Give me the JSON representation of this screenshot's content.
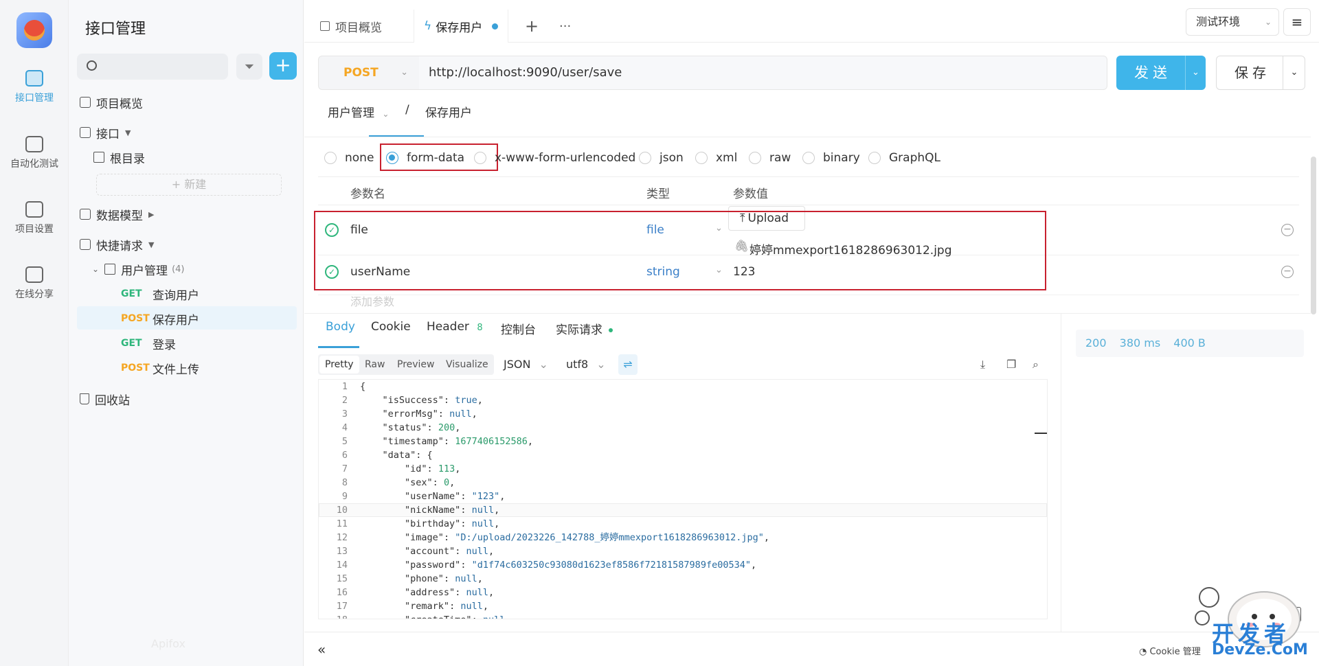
{
  "rail": {
    "items": [
      {
        "label": "接口管理",
        "icon": "api-icon",
        "active": true
      },
      {
        "label": "自动化测试",
        "icon": "automation-icon",
        "active": false
      },
      {
        "label": "项目设置",
        "icon": "settings-icon",
        "active": false
      },
      {
        "label": "在线分享",
        "icon": "share-icon",
        "active": false
      }
    ]
  },
  "sidebar": {
    "title": "接口管理",
    "search_placeholder": "",
    "overview": "项目概览",
    "interfaces": "接口",
    "root": "根目录",
    "new_label": "+ 新建",
    "data_model": "数据模型",
    "quick_requests": "快捷请求",
    "user_group": "用户管理",
    "user_group_count": "(4)",
    "requests": [
      {
        "method": "GET",
        "name": "查询用户"
      },
      {
        "method": "POST",
        "name": "保存用户"
      },
      {
        "method": "GET",
        "name": "登录"
      },
      {
        "method": "POST",
        "name": "文件上传"
      }
    ],
    "recycle": "回收站",
    "watermark": "Apifox"
  },
  "tabs": [
    {
      "label": "项目概览"
    },
    {
      "label": "保存用户"
    }
  ],
  "tab_add": "+",
  "tab_more": "···",
  "environment": "测试环境",
  "request": {
    "method": "POST",
    "url": "http://localhost:9090/user/save",
    "send_label": "发送",
    "save_label": "保存",
    "breadcrumb_parent": "用户管理",
    "breadcrumb_sep": "/",
    "breadcrumb_current": "保存用户"
  },
  "body_types": [
    "none",
    "form-data",
    "x-www-form-urlencoded",
    "json",
    "xml",
    "raw",
    "binary",
    "GraphQL"
  ],
  "params_header": {
    "name": "参数名",
    "type": "类型",
    "value": "参数值"
  },
  "params": [
    {
      "name": "file",
      "type": "file",
      "upload": "Upload",
      "value": "婷婷mmexport1618286963012.jpg"
    },
    {
      "name": "userName",
      "type": "string",
      "value": "123"
    }
  ],
  "add_param": "添加参数",
  "response": {
    "tabs": [
      "Body",
      "Cookie",
      "Header",
      "控制台",
      "实际请求"
    ],
    "header_count": "8",
    "formats": [
      "Pretty",
      "Raw",
      "Preview",
      "Visualize"
    ],
    "lang": "JSON",
    "encoding": "utf8",
    "status": "200",
    "time": "380 ms",
    "size": "400 B",
    "lines": [
      "{",
      "    \"isSuccess\": true,",
      "    \"errorMsg\": null,",
      "    \"status\": 200,",
      "    \"timestamp\": 1677406152586,",
      "    \"data\": {",
      "        \"id\": 113,",
      "        \"sex\": 0,",
      "        \"userName\": \"123\",",
      "        \"nickName\": null,",
      "        \"birthday\": null,",
      "        \"image\": \"D:/upload/2023226_142788_婷婷mmexport1618286963012.jpg\",",
      "        \"account\": null,",
      "        \"password\": \"d1f74c603250c93080d1623ef8586f72181587989fe00534\",",
      "        \"phone\": null,",
      "        \"address\": null,",
      "        \"remark\": null,",
      "        \"createTime\": null"
    ]
  },
  "footer": {
    "collapse": "«",
    "cookie": "Cookie 管理",
    "brand": "开发者",
    "brand_en": "DevZe.CoM"
  }
}
